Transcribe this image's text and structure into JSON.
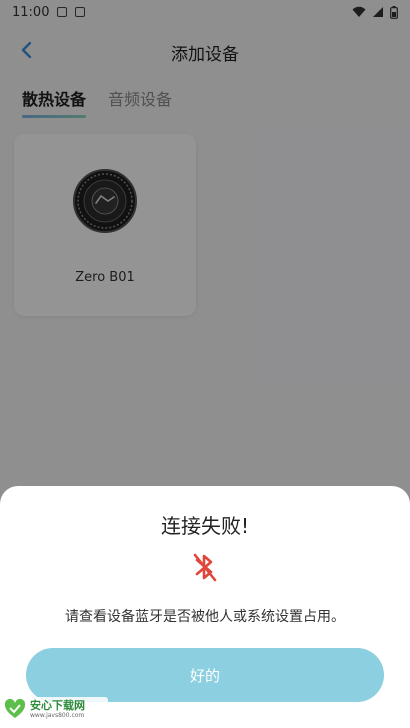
{
  "status_bar": {
    "time": "11:00"
  },
  "header": {
    "title": "添加设备"
  },
  "tabs": [
    {
      "label": "散热设备",
      "active": true
    },
    {
      "label": "音频设备",
      "active": false
    }
  ],
  "devices": [
    {
      "name": "Zero B01"
    }
  ],
  "dialog": {
    "title": "连接失败!",
    "message": "请查看设备蓝牙是否被他人或系统设置占用。",
    "ok_label": "好的"
  },
  "watermark": {
    "title": "安心下载网",
    "url": "www.javs800.com"
  },
  "colors": {
    "accent_button": "#8ccfe0",
    "error_icon": "#e0463c",
    "tab_underline": "#7fb2e6"
  }
}
